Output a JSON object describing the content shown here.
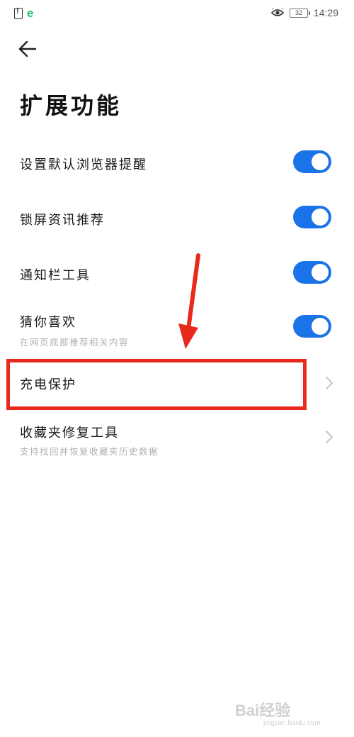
{
  "status_bar": {
    "time": "14:29",
    "battery_level": "32",
    "icons": [
      "sim-alert-icon",
      "browser-icon",
      "eye-icon",
      "battery-icon"
    ],
    "browser_icon_glyph": "e"
  },
  "header": {
    "back_icon": "arrow-left-icon",
    "title": "扩展功能"
  },
  "settings": [
    {
      "label": "设置默认浏览器提醒",
      "subtitle": "",
      "control": "toggle",
      "on": true
    },
    {
      "label": "锁屏资讯推荐",
      "subtitle": "",
      "control": "toggle",
      "on": true
    },
    {
      "label": "通知栏工具",
      "subtitle": "",
      "control": "toggle",
      "on": true
    },
    {
      "label": "猜你喜欢",
      "subtitle": "在网页底部推荐相关内容",
      "control": "toggle",
      "on": true
    },
    {
      "label": "充电保护",
      "subtitle": "",
      "control": "chevron",
      "highlighted": true
    },
    {
      "label": "收藏夹修复工具",
      "subtitle": "支持找回并恢复收藏夹历史数据",
      "control": "chevron"
    }
  ],
  "colors": {
    "toggle_on": "#1a73e8",
    "highlight": "#e8291c",
    "subtitle": "#b0b0b0"
  },
  "watermark": {
    "text": "Bai经验",
    "sub": "jingyan.baidu.com"
  }
}
